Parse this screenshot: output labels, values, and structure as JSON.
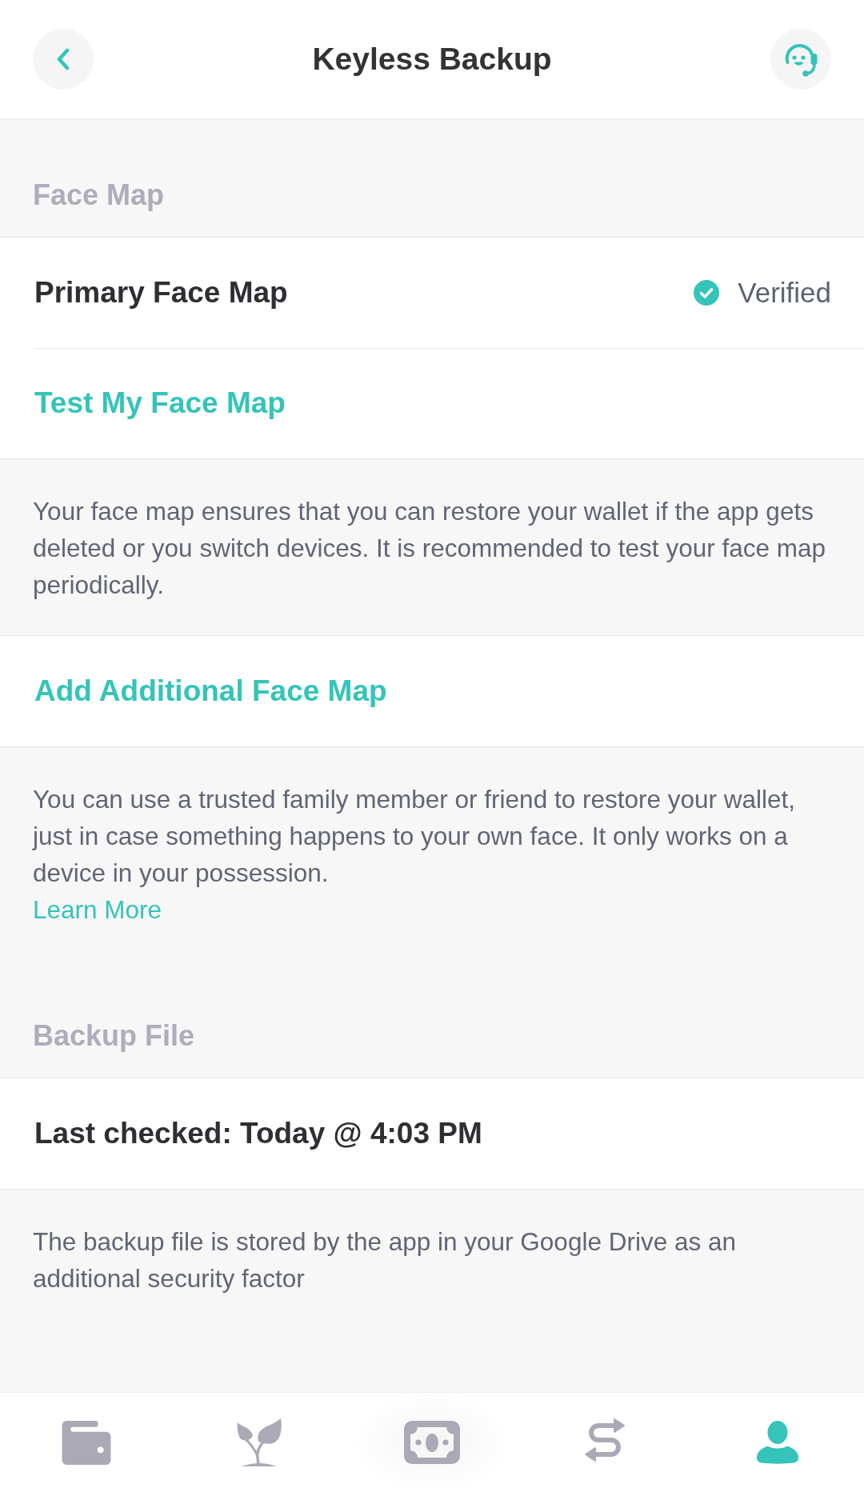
{
  "header": {
    "title": "Keyless Backup"
  },
  "blocks": [
    {
      "kind": "heading",
      "text": "Face Map"
    },
    {
      "kind": "status_row",
      "label": "Primary Face Map",
      "status": "Verified",
      "verified": true
    },
    {
      "kind": "action_row",
      "label": "Test My Face Map"
    },
    {
      "kind": "note",
      "text": "Your face map ensures that you can restore your wallet if the app gets deleted or you switch devices. It is recommended to test your face map periodically."
    },
    {
      "kind": "action_row",
      "label": "Add Additional Face Map"
    },
    {
      "kind": "note",
      "text": "You can use a trusted family member or friend to restore your wallet, just in case something happens to your own face. It only works on a device in your possession.",
      "link": "Learn More"
    },
    {
      "kind": "heading",
      "text": "Backup File"
    },
    {
      "kind": "value_row",
      "label": "Last checked: Today @ 4:03 PM"
    },
    {
      "kind": "note",
      "text": "The backup file is stored by the app in your Google Drive as an additional security factor"
    }
  ],
  "bottom_nav": [
    {
      "selected": false
    },
    {
      "selected": false
    },
    {
      "selected": false
    },
    {
      "selected": false
    },
    {
      "selected": true
    }
  ]
}
